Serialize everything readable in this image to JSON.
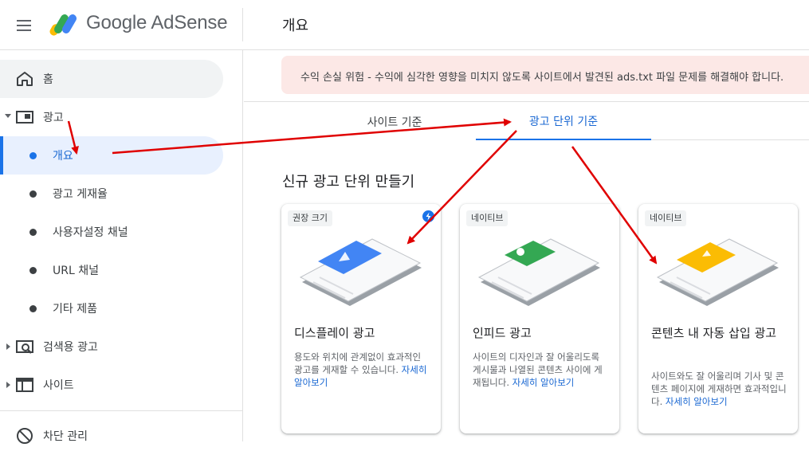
{
  "header": {
    "brand": "Google AdSense",
    "page_title": "개요",
    "icons": {
      "menu": "hamburger-menu-icon",
      "logo": "adsense-logo"
    }
  },
  "sidebar": {
    "home": {
      "label": "홈",
      "icon": "home-icon"
    },
    "ads": {
      "label": "광고",
      "icon": "ads-icon",
      "expanded": true
    },
    "ads_children": [
      {
        "label": "개요",
        "active": true
      },
      {
        "label": "광고 게재율",
        "active": false
      },
      {
        "label": "사용자설정 채널",
        "active": false
      },
      {
        "label": "URL 채널",
        "active": false
      },
      {
        "label": "기타 제품",
        "active": false
      }
    ],
    "search_ads": {
      "label": "검색용 광고",
      "icon": "search-ads-icon"
    },
    "sites": {
      "label": "사이트",
      "icon": "sites-icon"
    },
    "block": {
      "label": "차단 관리",
      "icon": "block-icon"
    }
  },
  "alert": {
    "text": "수익 손실 위험 - 수익에 심각한 영향을 미치지 않도록 사이트에서 발견된 ads.txt 파일 문제를 해결해야 합니다."
  },
  "tabs": [
    {
      "label": "사이트 기준",
      "active": false
    },
    {
      "label": "광고 단위 기준",
      "active": true
    }
  ],
  "section_title": "신규 광고 단위 만들기",
  "cards": [
    {
      "badge": "권장 크기",
      "title": "디스플레이 광고",
      "desc": "용도와 위치에 관계없이 효과적인 광고를 게재할 수 있습니다.",
      "link": "자세히 알아보기",
      "accent": "#4285f4"
    },
    {
      "badge": "네이티브",
      "title": "인피드 광고",
      "desc": "사이트의 디자인과 잘 어울리도록 게시물과 나열된 콘텐츠 사이에 게재됩니다.",
      "link": "자세히 알아보기",
      "accent": "#34a853"
    },
    {
      "badge": "네이티브",
      "title": "콘텐츠 내 자동 삽입 광고",
      "desc": "사이트와도 잘 어울리며 기사 및 콘텐츠 페이지에 게재하면 효과적입니다.",
      "link": "자세히 알아보기",
      "accent": "#fbbc04"
    }
  ],
  "colors": {
    "primary": "#1a73e8",
    "active_bg": "#e8f0fe",
    "alert_bg": "#fce8e6",
    "annotation": "#e00000"
  }
}
